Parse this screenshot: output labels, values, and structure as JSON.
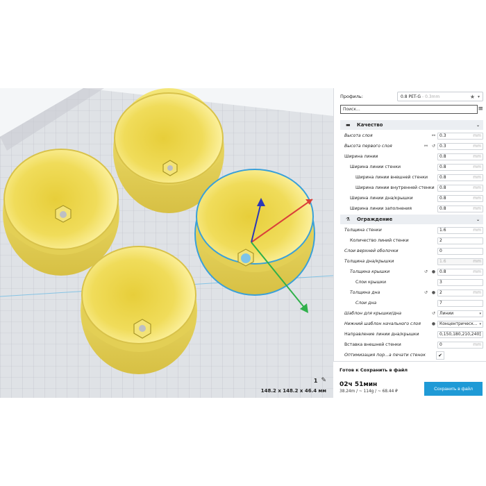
{
  "viewport": {
    "object_count": "1",
    "dimensions": "148.2 x 148.2 x 46.4 мм"
  },
  "profile": {
    "label": "Профиль:",
    "value": "0.8 PET-G",
    "muted": "- 0.3mm"
  },
  "search": {
    "placeholder": "Поиск..."
  },
  "quality": {
    "title": "Качество",
    "rows": [
      {
        "name": "Высота слоя",
        "value": "0.3",
        "unit": "mm"
      },
      {
        "name": "Высота первого слоя",
        "value": "0.3",
        "unit": "mm"
      },
      {
        "name": "Ширина линии",
        "value": "0.8",
        "unit": "mm"
      },
      {
        "name": "Ширина линии стенки",
        "value": "0.8",
        "unit": "mm"
      },
      {
        "name": "Ширина линии внешней стенки",
        "value": "0.8",
        "unit": "mm"
      },
      {
        "name": "Ширина линии внутренней стенки",
        "value": "0.8",
        "unit": "mm"
      },
      {
        "name": "Ширина линии дна/крышки",
        "value": "0.8",
        "unit": "mm"
      },
      {
        "name": "Ширина линии заполнения",
        "value": "0.8",
        "unit": "mm"
      }
    ]
  },
  "shell": {
    "title": "Ограждение",
    "rows": [
      {
        "name": "Толщина стенки",
        "value": "1.6",
        "unit": "mm"
      },
      {
        "name": "Количество линий стенки",
        "value": "2",
        "unit": ""
      },
      {
        "name": "Слои верхней оболочки",
        "value": "0",
        "unit": ""
      },
      {
        "name": "Толщина дна/крышки",
        "value": "1.6",
        "unit": "mm"
      },
      {
        "name": "Толщина крышки",
        "value": "0.8",
        "unit": "mm"
      },
      {
        "name": "Слои крышки",
        "value": "3",
        "unit": ""
      },
      {
        "name": "Толщина дна",
        "value": "2",
        "unit": "mm"
      },
      {
        "name": "Слои дна",
        "value": "7",
        "unit": ""
      },
      {
        "name": "Шаблон для крышки/дна",
        "value": "Линии",
        "unit": ""
      },
      {
        "name": "Нижний шаблон начального слоя",
        "value": "Концентрическ...",
        "unit": ""
      },
      {
        "name": "Направление линии дна/крышки",
        "value": "0,150,180,210,240]",
        "unit": ""
      },
      {
        "name": "Вставка внешней стенки",
        "value": "0",
        "unit": "mm"
      },
      {
        "name": "Оптимизация пор...а печати стенок",
        "value": "✔",
        "unit": ""
      }
    ]
  },
  "status": {
    "ready": "Готов к Сохранить в файл",
    "time": "02ч 51мин",
    "stats": "38.24m / ~ 114g / ~ 68.44 ₽",
    "save_label": "Сохранить в файл"
  },
  "colors": {
    "bowl": "#f1e57a",
    "accent": "#1f9ad6",
    "selection": "#3aa0d8"
  }
}
